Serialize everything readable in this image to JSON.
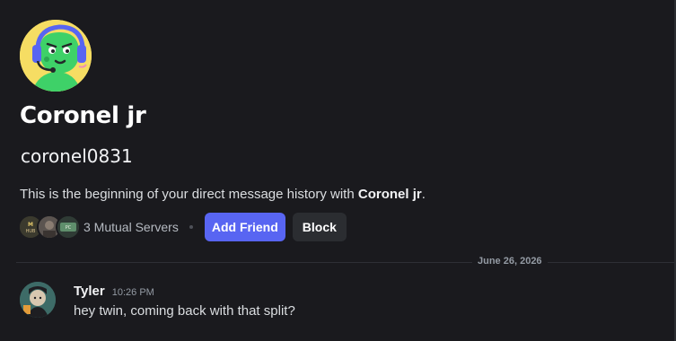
{
  "profile": {
    "display_name": "Coronel jr",
    "username": "coronel0831",
    "avatar_icon": "green-gamer-headset-avatar-icon"
  },
  "intro": {
    "prefix": "This is the beginning of your direct message history with ",
    "name": "Coronel jr",
    "suffix": "."
  },
  "actions": {
    "mutual_servers_label": "3 Mutual Servers",
    "mutual_server_icons": [
      "server-icon-1",
      "server-icon-2",
      "server-icon-3"
    ],
    "add_friend_label": "Add Friend",
    "block_label": "Block"
  },
  "divider": {
    "date": "June 26, 2026"
  },
  "messages": [
    {
      "author": "Tyler",
      "time": "10:26 PM",
      "text": "hey twin, coming back with that split?",
      "avatar_icon": "user-avatar-icon"
    }
  ],
  "colors": {
    "background": "#1a1a1e",
    "primary_button": "#5865f2",
    "secondary_button": "#2b2d31",
    "avatar_bg": "#f6dd63",
    "avatar_character": "#3ed168",
    "headset": "#5865f2"
  }
}
